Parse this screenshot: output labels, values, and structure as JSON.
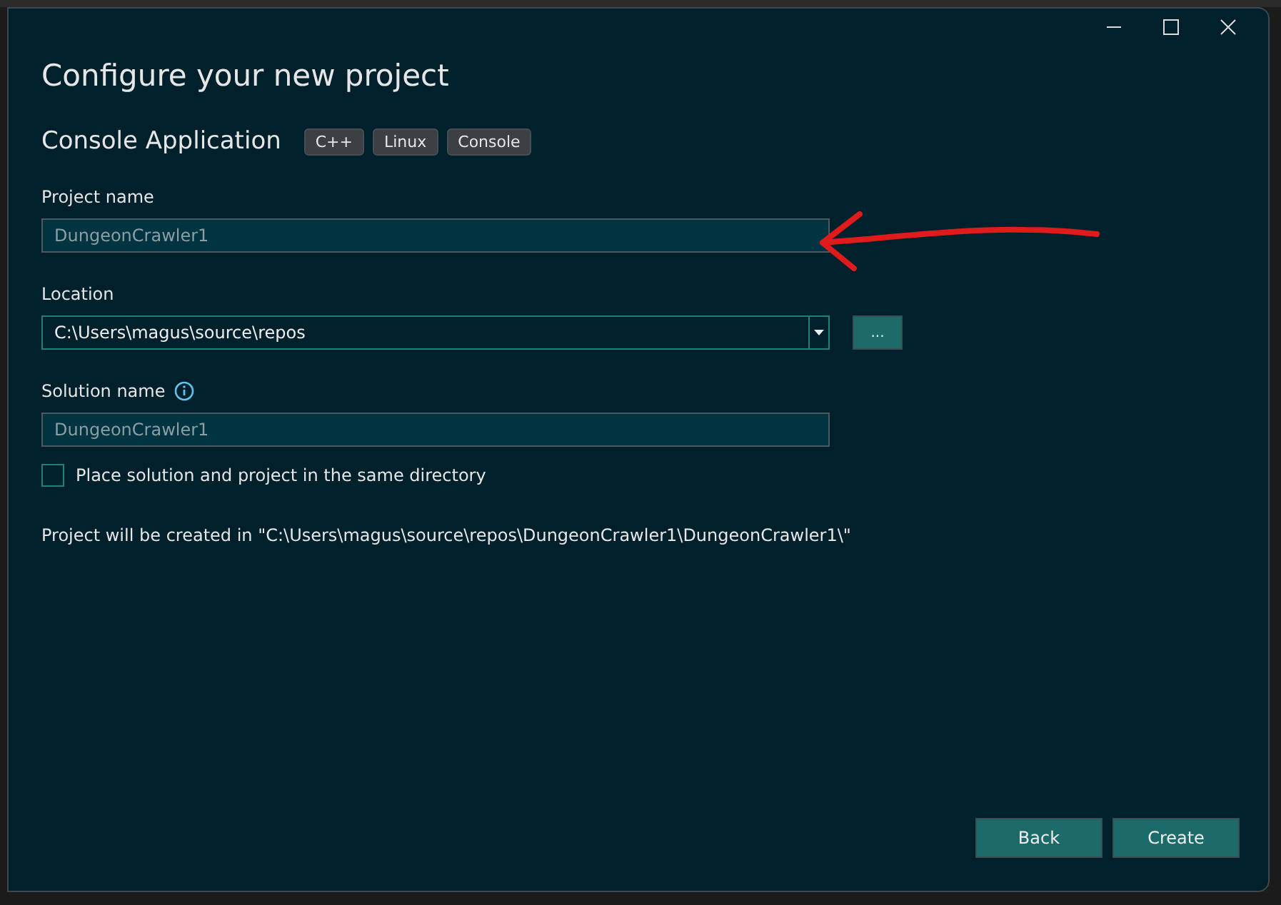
{
  "window": {
    "title": "Configure your new project"
  },
  "template": {
    "name": "Console Application",
    "tags": [
      "C++",
      "Linux",
      "Console"
    ]
  },
  "project_name": {
    "label": "Project name",
    "placeholder": "DungeonCrawler1"
  },
  "location": {
    "label": "Location",
    "value": "C:\\Users\\magus\\source\\repos",
    "browse": "..."
  },
  "solution_name": {
    "label": "Solution name",
    "placeholder": "DungeonCrawler1"
  },
  "same_directory": {
    "label": "Place solution and project in the same directory",
    "checked": false
  },
  "summary": "Project will be created in \"C:\\Users\\magus\\source\\repos\\DungeonCrawler1\\DungeonCrawler1\\\"",
  "buttons": [
    "Back",
    "Create"
  ]
}
